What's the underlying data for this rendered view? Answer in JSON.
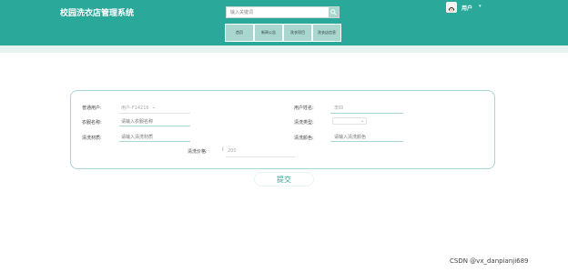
{
  "header": {
    "app_title": "校园洗衣店管理系统",
    "search_placeholder": "输入关键词",
    "user_label": "用户",
    "user_caret": "▾"
  },
  "nav": {
    "items": [
      {
        "label": "首页"
      },
      {
        "label": "新闻公告"
      },
      {
        "label": "洗衣项目"
      },
      {
        "label": "洗衣店信息"
      }
    ]
  },
  "form": {
    "fields": [
      {
        "label": "普通用户:",
        "value": "用户-F14216",
        "kind": "select"
      },
      {
        "label": "用户姓名:",
        "value": "李四",
        "kind": "readonly"
      },
      {
        "label": "衣服名称:",
        "placeholder": "请输入衣服名称",
        "kind": "input"
      },
      {
        "label": "清洗类型:",
        "value": "",
        "kind": "select"
      },
      {
        "label": "清洗材质:",
        "placeholder": "请输入清洗材质",
        "kind": "input"
      },
      {
        "label": "清洗颜色:",
        "placeholder": "请输入清洗颜色",
        "kind": "input"
      },
      {
        "label": "清洗价格:",
        "value": "200",
        "kind": "number"
      }
    ],
    "submit_label": "提交"
  },
  "watermark": "CSDN @vx_danpianji689",
  "colors": {
    "header_bg": "#2aa89a",
    "accent_light": "#a9d6cf",
    "accent_text": "#2aa89a"
  },
  "icons": [
    "search-icon",
    "avatar",
    "chevron-down-icon"
  ]
}
